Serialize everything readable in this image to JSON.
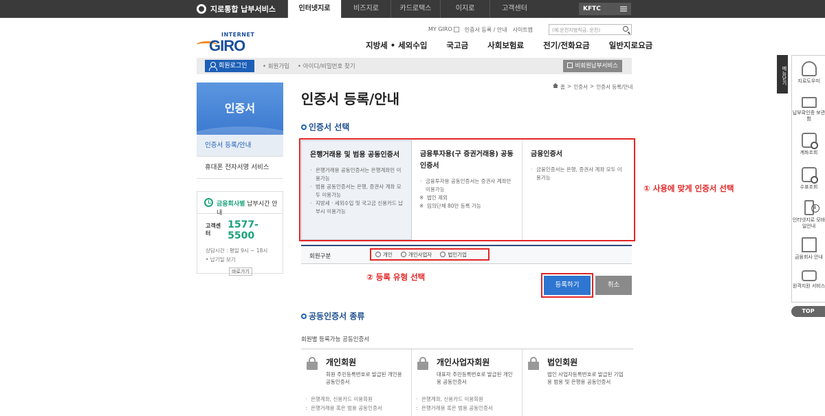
{
  "topbar": {
    "brand": "지로통합 납부서비스",
    "tabs": [
      "인터넷지로",
      "비즈지로",
      "카드로택스",
      "이지로",
      "고객센터"
    ],
    "active_tab": 0,
    "kftc": "KFTC"
  },
  "logo": {
    "internet": "INTERNET",
    "giro": "GIRO"
  },
  "utility": {
    "mygiro": "MY GIRO",
    "cert": "인증서 등록 / 안내",
    "sitemap": "사이트맵"
  },
  "search": {
    "placeholder": "(예.운전자범칙금, 운전)"
  },
  "mainnav": [
    "지방세 • 세외수입",
    "국고금",
    "사회보험료",
    "전기/전화요금",
    "일반지로요금"
  ],
  "loginbar": {
    "login": "회원로그인",
    "join": "• 회원가입",
    "find": "• 아이디/비밀번호 찾기",
    "nonmember": "비회원납부서비스"
  },
  "lnb": {
    "title": "인증서",
    "items": [
      "인증서 등록/안내",
      "휴대폰 전자서명 서비스"
    ]
  },
  "infobox": {
    "head_em": "금융회사별",
    "head_rest": "납부시간 안내",
    "cc_label": "고객센터",
    "cc_number": "1577-5500",
    "hours": "상담시간 : 평일 9시 ~ 18시",
    "holiday": "• 납기일 보기",
    "shortcut": "바로가기"
  },
  "page": {
    "title": "인증서 등록/안내",
    "breadcrumb": [
      "홈",
      ">",
      "인증서",
      ">",
      "인증서 등록/안내"
    ],
    "section1": "인증서 선택",
    "section2": "공동인증서 종류",
    "subhead": "회원별 등록가능 공동인증서"
  },
  "cert_cards": [
    {
      "title": "은행거래용 및 범용 공동인증서",
      "items": [
        "은행거래용 공동인증서는 은행계좌만 이용가능",
        "범용 공동인증서는 은행, 증권사 계좌 모두 이용가능",
        "지방세 · 세외수입 및 국고금 신용카드 납부시 이용가능"
      ],
      "notes": []
    },
    {
      "title": "금융투자용(구 증권거래용) 공동인증서",
      "items": [
        "금융투자용 공동인증서는 증권사 계좌만 이용가능"
      ],
      "notes": [
        "법인 제외",
        "임의단체 80만 등록 가능"
      ]
    },
    {
      "title": "금융인증서",
      "items": [
        "금융인증서는 은행, 증권사 계좌 모두 이용가능"
      ],
      "notes": []
    }
  ],
  "member_type": {
    "label": "회원구분",
    "options": [
      "개인",
      "개인사업자",
      "법인기업"
    ]
  },
  "annotations": {
    "step1": "① 사용에 맞게 인증서 선택",
    "step2": "② 등록 유형 선택"
  },
  "buttons": {
    "register": "등록하기",
    "cancel": "취소"
  },
  "member_cards": [
    {
      "title": "개인회원",
      "desc": "회원 주민등록번호로 발급된 개인용 공동인증서",
      "items": [
        "은행계좌, 신용카드 이용회원"
      ],
      "cont": [
        "은행거래용 혹은 범용 공동인증서"
      ]
    },
    {
      "title": "개인사업자회원",
      "desc": "대표자 주민등록번호로 발급된 개인용 공동인증서",
      "items": [
        "은행계좌, 신용카드 이용회원"
      ],
      "cont": [
        "은행거래용 혹은 범용 공동인증서"
      ]
    },
    {
      "title": "법인회원",
      "desc": "법인 사업자등록번호로 발급된 기업용 범용 및 은행용 공동인증서",
      "items": [],
      "cont": []
    }
  ],
  "quickmenu": {
    "toggle": "메뉴닫기",
    "items": [
      {
        "label": "지로도우미",
        "icon": "headset-icon"
      },
      {
        "label": "납부확인증 보관함",
        "icon": "folder-icon"
      },
      {
        "label": "계좌조회",
        "icon": "search-doc-icon"
      },
      {
        "label": "수표조회",
        "icon": "search-receipt-icon"
      },
      {
        "label": "인터넷지로 모바일안내",
        "icon": "mobile-info-icon"
      },
      {
        "label": "금융회사 안내",
        "icon": "bank-icon"
      },
      {
        "label": "원격지원 서비스",
        "icon": "remote-support-icon"
      }
    ],
    "top": "TOP"
  },
  "colors": {
    "primary": "#1d5fb7",
    "accent_green": "#1aa37a",
    "annotation_red": "#e22626",
    "topbar": "#3a3a3a"
  }
}
